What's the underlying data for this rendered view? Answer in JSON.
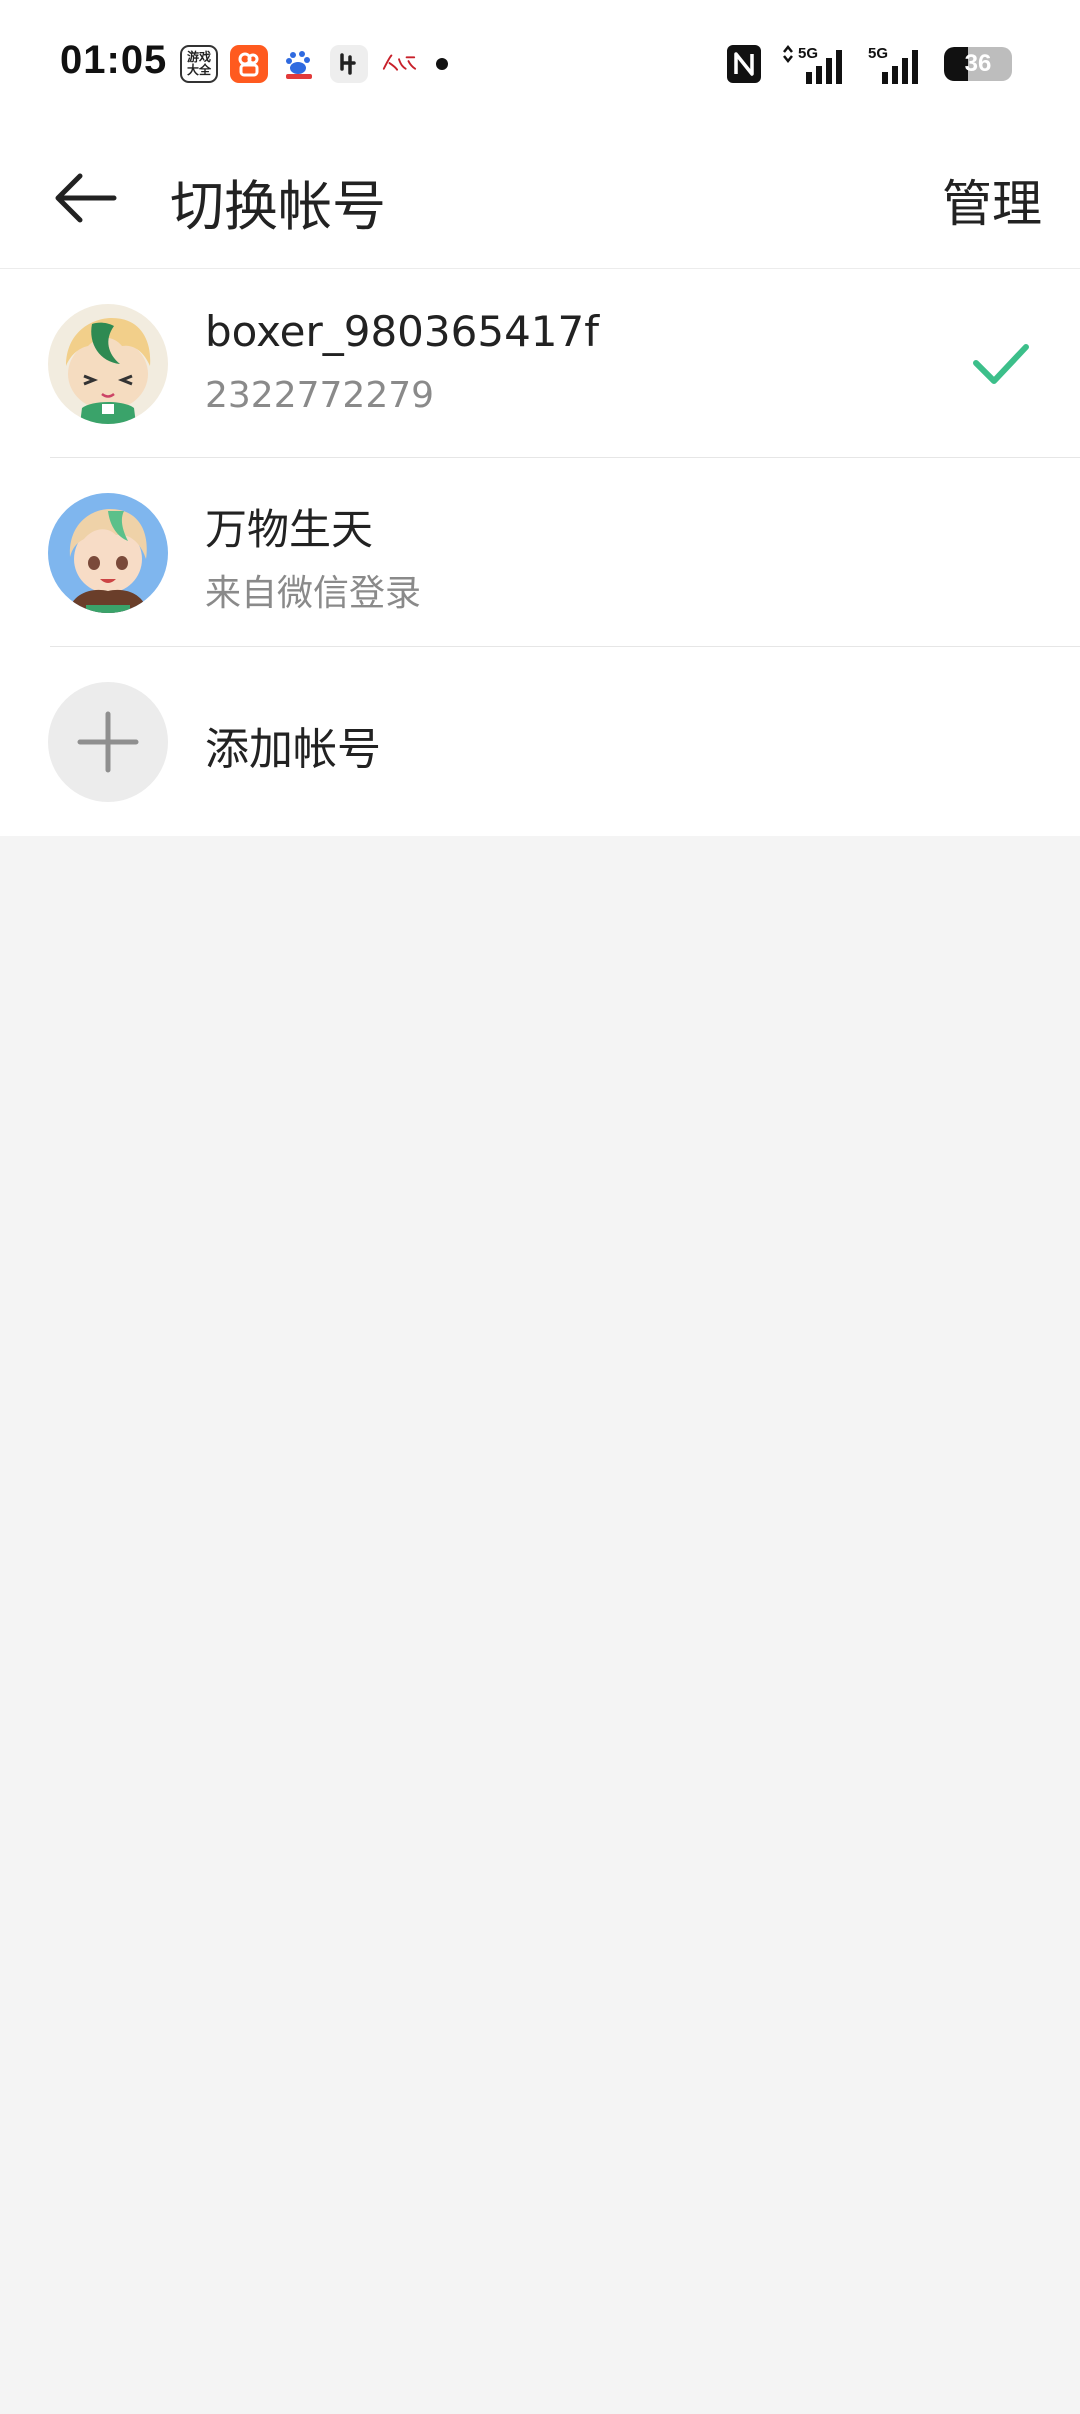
{
  "status_bar": {
    "time": "01:05",
    "notification_icons": [
      "games-hub-icon",
      "kuaishou-icon",
      "baidu-icon",
      "app-icon",
      "peoples-daily-icon"
    ],
    "notif_games_label": "游戏\n大全",
    "network": [
      "5G",
      "5G"
    ],
    "battery_level": "36",
    "battery_fraction": 0.36
  },
  "header": {
    "title": "切换帐号",
    "manage_label": "管理"
  },
  "accounts": [
    {
      "name": "boxer_980365417f",
      "subtitle": "2322772279",
      "selected": true,
      "avatar_icon": "anime-avatar-green-hair-icon"
    },
    {
      "name": "万物生天",
      "subtitle": "来自微信登录",
      "selected": false,
      "avatar_icon": "anime-avatar-blue-background-icon"
    }
  ],
  "add_account": {
    "label": "添加帐号",
    "icon": "plus-icon"
  },
  "colors": {
    "accent_check": "#3cbf8a",
    "background": "#f4f4f4",
    "surface": "#ffffff",
    "secondary_text": "#8a8a8a"
  }
}
